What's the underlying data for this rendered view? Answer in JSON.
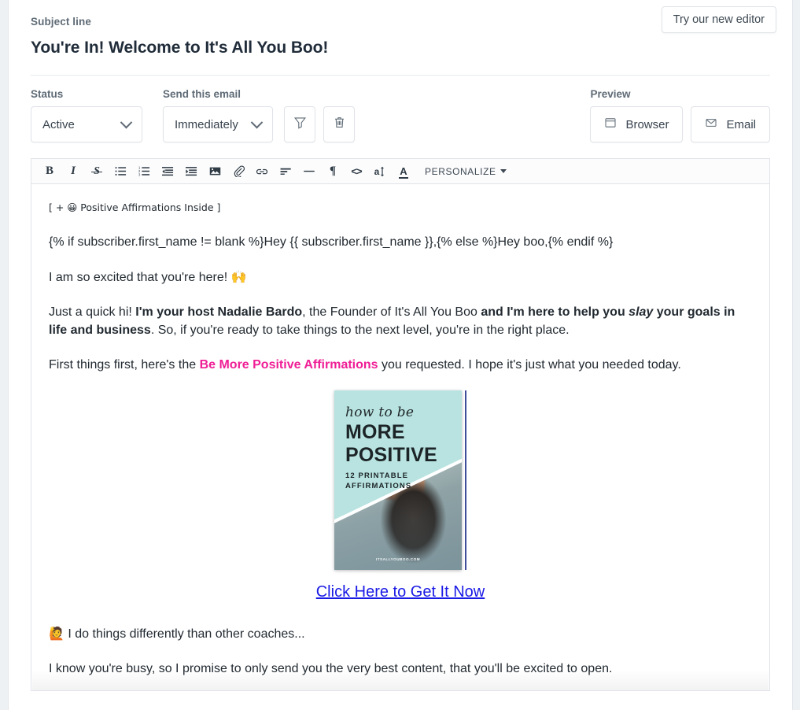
{
  "header": {
    "subject_label": "Subject line",
    "subject_value": "You're In! Welcome to It's All You Boo!",
    "try_editor_label": "Try our new editor"
  },
  "controls": {
    "status": {
      "label": "Status",
      "value": "Active"
    },
    "send": {
      "label": "Send this email",
      "value": "Immediately"
    },
    "filter_icon": "funnel-icon",
    "delete_icon": "trash-icon",
    "preview": {
      "label": "Preview",
      "browser_label": "Browser",
      "email_label": "Email"
    }
  },
  "toolbar": {
    "bold": "B",
    "italic": "I",
    "strikethrough": "S",
    "bulleted_list": "bulleted-list-icon",
    "numbered_list": "numbered-list-icon",
    "outdent": "outdent-icon",
    "indent": "indent-icon",
    "image": "image-icon",
    "attachment": "paperclip-icon",
    "link": "link-icon",
    "align": "align-left-icon",
    "horizontal_rule": "horizontal-rule-icon",
    "paragraph": "pilcrow-icon",
    "source_code": "code-icon",
    "line_height": "line-height-icon",
    "text_color": "text-color-icon",
    "personalize_label": "PERSONALIZE"
  },
  "email_body": {
    "preheader": "[ + 😀 Positive Affirmations Inside ]",
    "greeting": "{% if subscriber.first_name != blank %}Hey {{ subscriber.first_name }},{% else %}Hey boo,{% endif %}",
    "excited_text": "I am so excited that you're here! ",
    "excited_emoji": "🙌",
    "intro_part1": "Just a quick hi! ",
    "intro_bold1": "I'm your host Nadalie Bardo",
    "intro_part2": ", the Founder of It's All You Boo ",
    "intro_bold2": "and I'm here to help you ",
    "intro_italic": "slay",
    "intro_bold3": " your goals in life and business",
    "intro_part3": ". So, if you're ready to take things to the next level, you're in the right place.",
    "first_things_part1": "First things first, here's the ",
    "first_things_pink": "Be More Positive Affirmations",
    "first_things_part2": " you requested. I hope it's just what you needed today.",
    "ebook": {
      "script_line": "how to be",
      "title_line1": "MORE",
      "title_line2": "POSITIVE",
      "subtitle": "12 PRINTABLE\nAFFIRMATIONS",
      "url": "ITSALLYOUBOO.COM"
    },
    "cta_link": "Click Here to Get It Now",
    "differently_emoji": "🙋",
    "differently_text": " I do things differently than other coaches...",
    "promise_text": "I know you're busy, so I promise to only send you the very best content, that you'll be excited to open."
  },
  "colors": {
    "pink_accent": "#ef1e96",
    "link_blue": "#1a1ae6",
    "text_dark": "#222a31",
    "label_gray": "#5f6b76",
    "border_gray": "#dfe3e8"
  }
}
